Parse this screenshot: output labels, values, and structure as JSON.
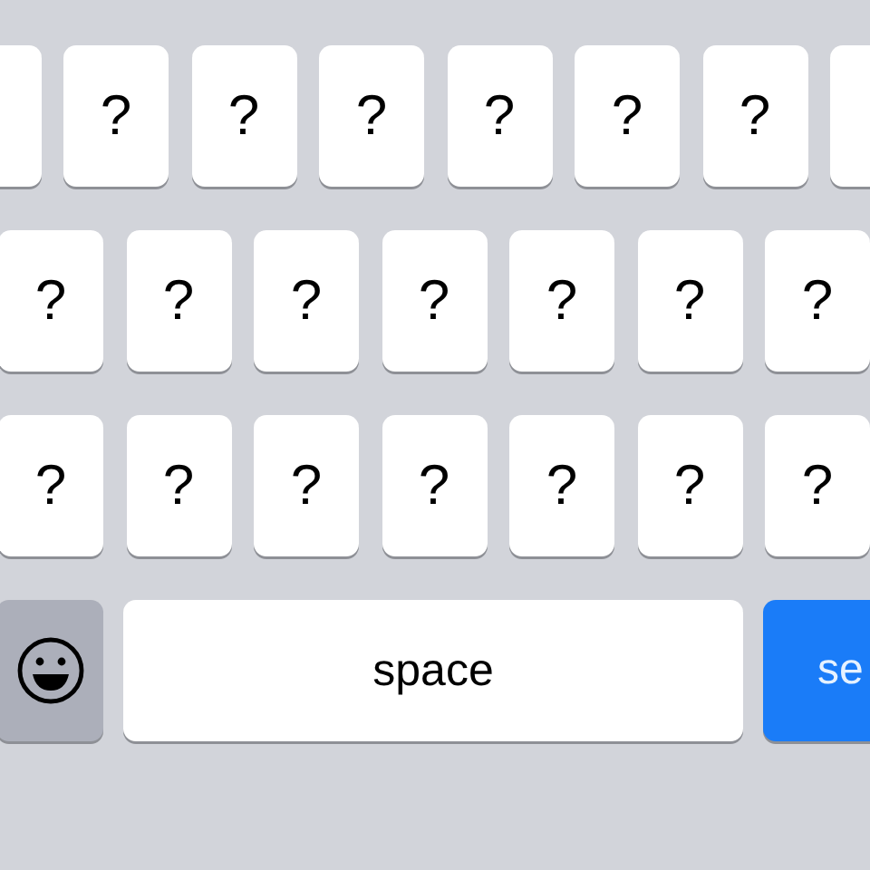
{
  "rows": [
    {
      "keys": [
        {
          "kind": "letter"
        },
        {
          "kind": "letter",
          "label": "?"
        },
        {
          "kind": "letter",
          "label": "?"
        },
        {
          "kind": "letter",
          "label": "?"
        },
        {
          "kind": "letter",
          "label": "?"
        },
        {
          "kind": "letter",
          "label": "?"
        },
        {
          "kind": "letter",
          "label": "?"
        },
        {
          "kind": "letter"
        }
      ]
    },
    {
      "keys": [
        {
          "kind": "letter",
          "label": "?"
        },
        {
          "kind": "letter",
          "label": "?"
        },
        {
          "kind": "letter",
          "label": "?"
        },
        {
          "kind": "letter",
          "label": "?"
        },
        {
          "kind": "letter",
          "label": "?"
        },
        {
          "kind": "letter",
          "label": "?"
        },
        {
          "kind": "letter",
          "label": "?"
        }
      ]
    },
    {
      "keys": [
        {
          "kind": "letter",
          "label": "?"
        },
        {
          "kind": "letter",
          "label": "?"
        },
        {
          "kind": "letter",
          "label": "?"
        },
        {
          "kind": "letter",
          "label": "?"
        },
        {
          "kind": "letter",
          "label": "?"
        },
        {
          "kind": "letter",
          "label": "?"
        },
        {
          "kind": "letter",
          "label": "?"
        }
      ]
    },
    {
      "keys": [
        {
          "kind": "emoji"
        },
        {
          "kind": "space",
          "label": "space"
        },
        {
          "kind": "send",
          "label": "se"
        }
      ]
    }
  ]
}
